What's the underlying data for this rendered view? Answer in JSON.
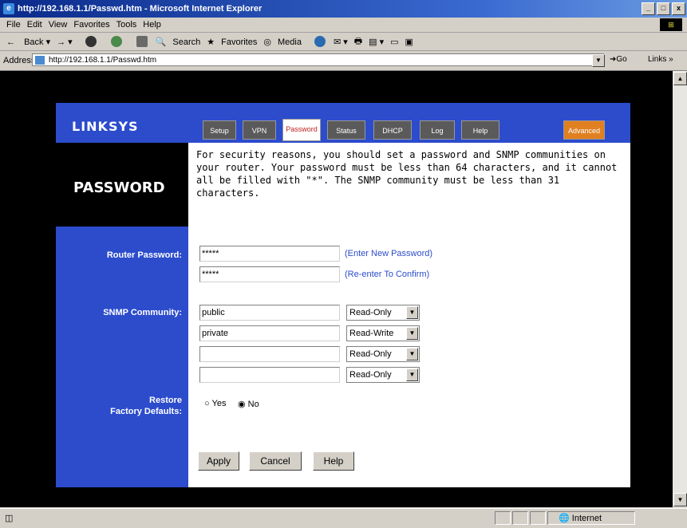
{
  "window": {
    "title": "http://192.168.1.1/Passwd.htm - Microsoft Internet Explorer",
    "controls": [
      "_",
      "□",
      "x"
    ]
  },
  "menu": [
    "File",
    "Edit",
    "View",
    "Favorites",
    "Tools",
    "Help"
  ],
  "toolbar": {
    "back": "Back",
    "search": "Search",
    "favorites": "Favorites",
    "media": "Media"
  },
  "address": {
    "label": "Address",
    "url": "http://192.168.1.1/Passwd.htm",
    "go": "Go",
    "links": "Links"
  },
  "page": {
    "logo": "LINKSYS",
    "tabs": [
      "Setup",
      "VPN",
      "Password",
      "Status",
      "DHCP",
      "Log",
      "Help"
    ],
    "advanced_tab": "Advanced",
    "section_title": "PASSWORD",
    "description": "For security reasons, you should set a password and SNMP communities on your router. Your password must be less than 64 characters, and it cannot all be filled with \"*\". The SNMP community must be less than 31 characters.",
    "labels": {
      "router_password": "Router Password:",
      "snmp_community": "SNMP Community:",
      "restore_line1": "Restore",
      "restore_line2": "Factory Defaults:"
    },
    "password_value": "*****",
    "confirm_value": "*****",
    "enter_hint": "(Enter New Password)",
    "confirm_hint": "(Re-enter To Confirm)",
    "communities": [
      {
        "value": "public",
        "access": "Read-Only"
      },
      {
        "value": "private",
        "access": "Read-Write"
      },
      {
        "value": "",
        "access": "Read-Only"
      },
      {
        "value": "",
        "access": "Read-Only"
      }
    ],
    "restore_yes": "Yes",
    "restore_no": "No",
    "buttons": {
      "apply": "Apply",
      "cancel": "Cancel",
      "help": "Help"
    }
  },
  "status": {
    "zone": "Internet"
  }
}
